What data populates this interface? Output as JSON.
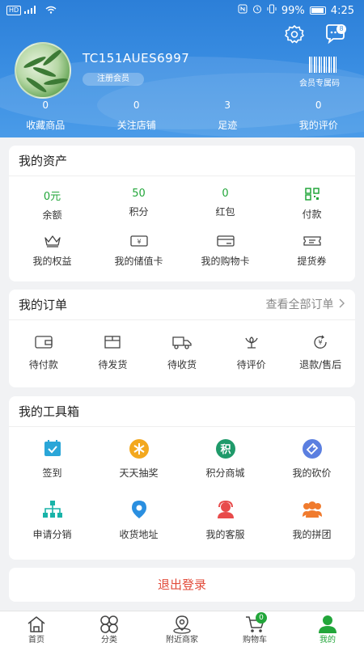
{
  "statusbar": {
    "left": "HD ⁴ᴳ",
    "battery": "99%",
    "time": "4:25"
  },
  "profile": {
    "username": "TC151AUES6997",
    "member_level": "注册会员",
    "member_code_label": "会员专属码",
    "message_count": "8"
  },
  "stats": [
    {
      "value": "0",
      "label": "收藏商品"
    },
    {
      "value": "0",
      "label": "关注店铺"
    },
    {
      "value": "3",
      "label": "足迹"
    },
    {
      "value": "0",
      "label": "我的评价"
    }
  ],
  "assets": {
    "title": "我的资产",
    "values": [
      {
        "value": "0元",
        "label": "余额"
      },
      {
        "value": "50",
        "label": "积分"
      },
      {
        "value": "0",
        "label": "红包"
      },
      {
        "label": "付款",
        "icon": "qr-pay-icon"
      }
    ],
    "items": [
      {
        "label": "我的权益",
        "icon": "crown-icon"
      },
      {
        "label": "我的储值卡",
        "icon": "stored-card-icon"
      },
      {
        "label": "我的购物卡",
        "icon": "shopping-card-icon"
      },
      {
        "label": "提货券",
        "icon": "coupon-icon"
      }
    ]
  },
  "orders": {
    "title": "我的订单",
    "view_all": "查看全部订单",
    "items": [
      {
        "label": "待付款",
        "icon": "wallet-icon"
      },
      {
        "label": "待发货",
        "icon": "box-icon"
      },
      {
        "label": "待收货",
        "icon": "truck-icon"
      },
      {
        "label": "待评价",
        "icon": "flower-icon"
      },
      {
        "label": "退款/售后",
        "icon": "refund-icon"
      }
    ]
  },
  "toolbox": {
    "title": "我的工具箱",
    "items": [
      {
        "label": "签到",
        "icon": "calendar-check-icon",
        "color": "#2aa6d8"
      },
      {
        "label": "天天抽奖",
        "icon": "lottery-icon",
        "color": "#f3a81e"
      },
      {
        "label": "积分商城",
        "icon": "points-icon",
        "color": "#1f9a6a"
      },
      {
        "label": "我的砍价",
        "icon": "bargain-icon",
        "color": "#5b7fe0"
      },
      {
        "label": "申请分销",
        "icon": "org-chart-icon",
        "color": "#19b3a8"
      },
      {
        "label": "收货地址",
        "icon": "location-icon",
        "color": "#2a8fe0"
      },
      {
        "label": "我的客服",
        "icon": "support-icon",
        "color": "#e84b4b"
      },
      {
        "label": "我的拼团",
        "icon": "group-icon",
        "color": "#f07b2e"
      }
    ]
  },
  "logout_label": "退出登录",
  "nav": [
    {
      "label": "首页",
      "icon": "home-icon"
    },
    {
      "label": "分类",
      "icon": "category-icon"
    },
    {
      "label": "附近商家",
      "icon": "nearby-icon"
    },
    {
      "label": "购物车",
      "icon": "cart-icon",
      "badge": "0"
    },
    {
      "label": "我的",
      "icon": "user-icon",
      "active": true
    }
  ],
  "colors": {
    "header": "#3b8fe3",
    "accent_green": "#22a63a",
    "logout_red": "#e24b3a"
  }
}
